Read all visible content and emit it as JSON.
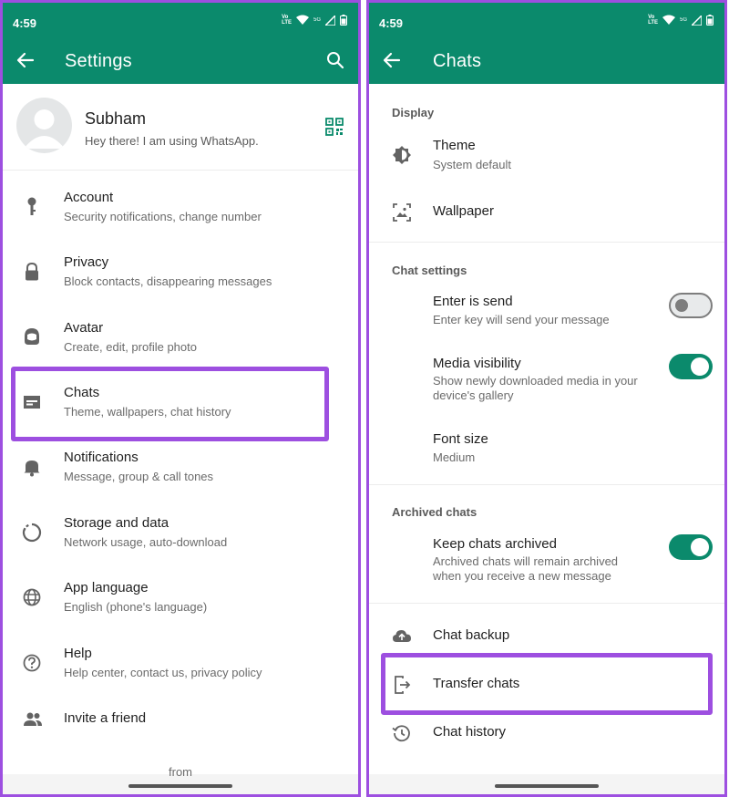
{
  "left": {
    "status": {
      "time": "4:59",
      "volte": "Vo)) LTE",
      "net": "5G"
    },
    "appbar": {
      "title": "Settings"
    },
    "profile": {
      "name": "Subham",
      "status": "Hey there! I am using WhatsApp."
    },
    "items": [
      {
        "title": "Account",
        "subtitle": "Security notifications, change number",
        "icon": "key-icon"
      },
      {
        "title": "Privacy",
        "subtitle": "Block contacts, disappearing messages",
        "icon": "lock-icon"
      },
      {
        "title": "Avatar",
        "subtitle": "Create, edit, profile photo",
        "icon": "avatar-face-icon"
      },
      {
        "title": "Chats",
        "subtitle": "Theme, wallpapers, chat history",
        "icon": "chat-icon"
      },
      {
        "title": "Notifications",
        "subtitle": "Message, group & call tones",
        "icon": "bell-icon"
      },
      {
        "title": "Storage and data",
        "subtitle": "Network usage, auto-download",
        "icon": "storage-circle-icon"
      },
      {
        "title": "App language",
        "subtitle": "English (phone's language)",
        "icon": "globe-icon"
      },
      {
        "title": "Help",
        "subtitle": "Help center, contact us, privacy policy",
        "icon": "help-icon"
      },
      {
        "title": "Invite a friend",
        "subtitle": "",
        "icon": "people-icon"
      }
    ],
    "footer": "from"
  },
  "right": {
    "status": {
      "time": "4:59",
      "volte": "Vo)) LTE",
      "net": "5G"
    },
    "appbar": {
      "title": "Chats"
    },
    "sections": {
      "display": "Display",
      "chat_settings": "Chat settings",
      "archived": "Archived chats"
    },
    "theme": {
      "title": "Theme",
      "subtitle": "System default"
    },
    "wallpaper": {
      "title": "Wallpaper"
    },
    "enter_send": {
      "title": "Enter is send",
      "subtitle": "Enter key will send your message",
      "enabled": false
    },
    "media_visibility": {
      "title": "Media visibility",
      "subtitle_line1": "Show newly downloaded media in your",
      "subtitle_line2": "device's gallery",
      "enabled": true
    },
    "font_size": {
      "title": "Font size",
      "subtitle": "Medium"
    },
    "keep_archived": {
      "title": "Keep chats archived",
      "subtitle_line1": "Archived chats will remain archived",
      "subtitle_line2": "when you receive a new message",
      "enabled": true
    },
    "chat_backup": {
      "title": "Chat backup"
    },
    "transfer": {
      "title": "Transfer chats"
    },
    "history": {
      "title": "Chat history"
    }
  },
  "colors": {
    "brand": "#0b8a6c",
    "highlight": "#9d4fe0",
    "icon": "#636363"
  }
}
